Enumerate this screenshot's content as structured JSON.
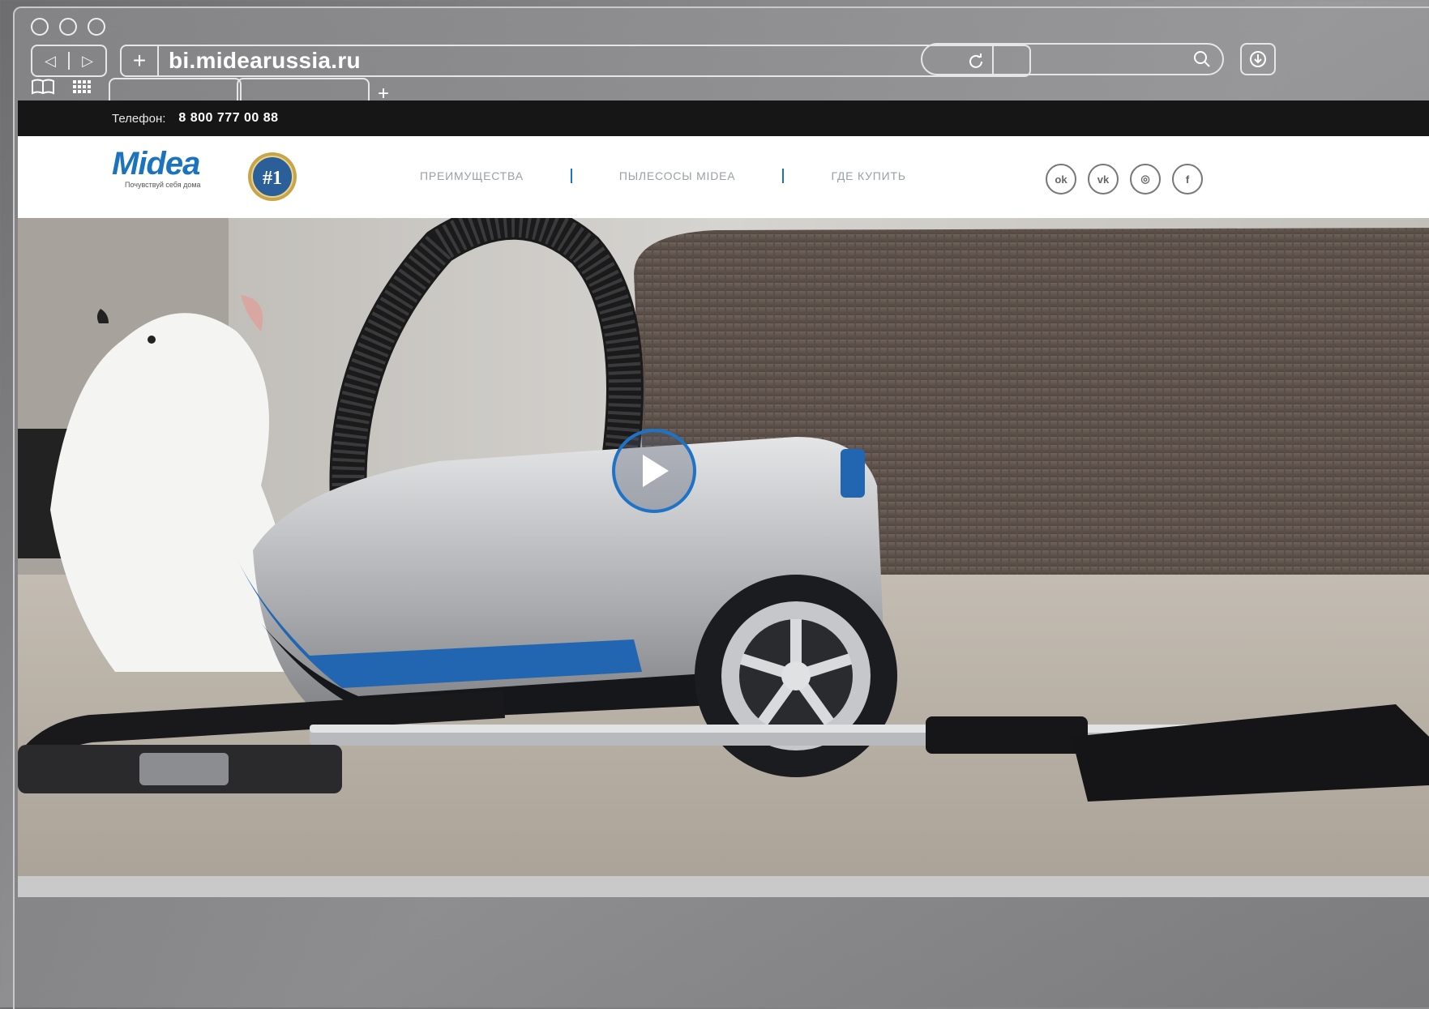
{
  "browser": {
    "url": "bi.midearussia.ru",
    "new_tab_symbol": "+",
    "address_plus": "+"
  },
  "site": {
    "phone_label": "Телефон:",
    "phone_number": "8 800 777 00 88",
    "logo_text": "Midea",
    "logo_tagline": "Почувствуй себя дома",
    "badge_text": "#1",
    "nav": [
      "ПРЕИМУЩЕСТВА",
      "ПЫЛЕСОСЫ MIDEA",
      "ГДЕ КУПИТЬ"
    ],
    "social": [
      {
        "icon": "odnoklassniki-icon",
        "glyph": "ok"
      },
      {
        "icon": "vk-icon",
        "glyph": "vk"
      },
      {
        "icon": "instagram-icon",
        "glyph": "◎"
      },
      {
        "icon": "facebook-icon",
        "glyph": "f"
      }
    ],
    "colors": {
      "brand": "#1c73bd",
      "topstrip": "#161616",
      "nav_text": "#9aa0a6"
    }
  }
}
